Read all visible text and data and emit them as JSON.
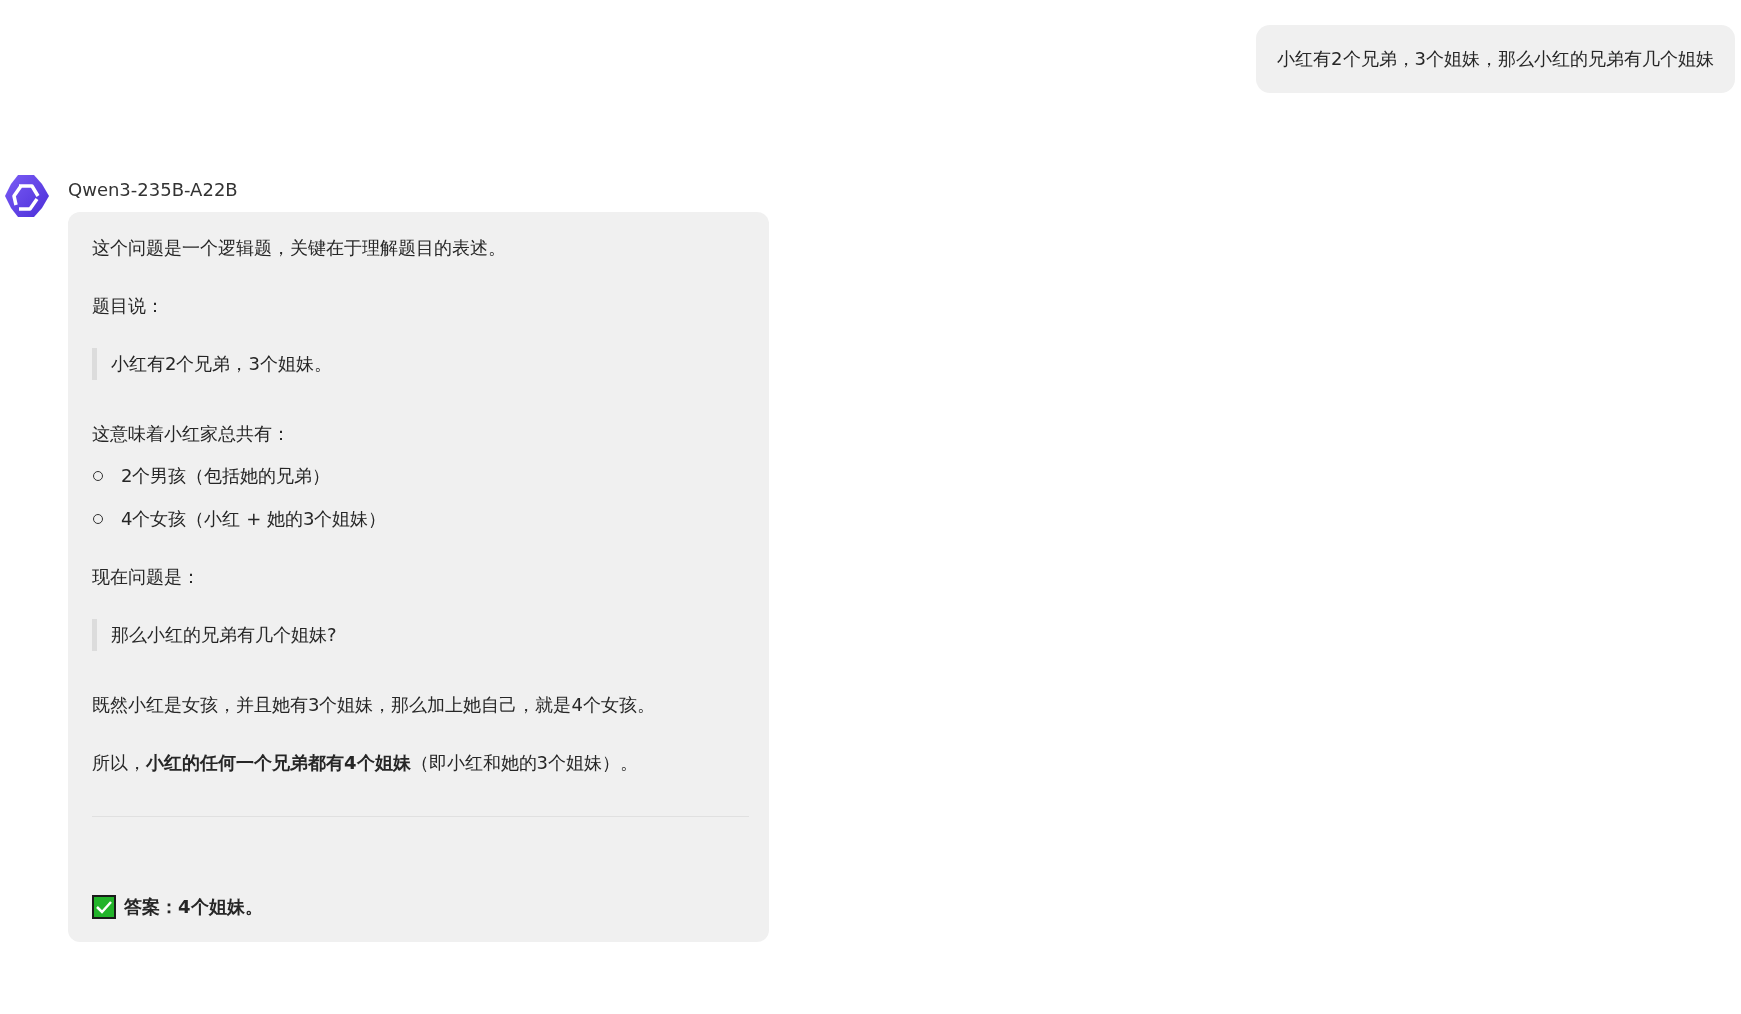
{
  "user_message": {
    "text": "小红有2个兄弟，3个姐妹，那么小红的兄弟有几个姐妹"
  },
  "assistant": {
    "model_name": "Qwen3-235B-A22B",
    "blocks": [
      {
        "kind": "paragraph",
        "text": "这个问题是一个逻辑题，关键在于理解题目的表述。"
      },
      {
        "kind": "paragraph",
        "text": "题目说："
      },
      {
        "kind": "quote",
        "text": "小红有2个兄弟，3个姐妹。"
      },
      {
        "kind": "paragraph",
        "text": "这意味着小红家总共有："
      },
      {
        "kind": "bullets",
        "items": [
          "2个男孩（包括她的兄弟）",
          "4个女孩（小红 + 她的3个姐妹）"
        ]
      },
      {
        "kind": "paragraph",
        "text": "现在问题是："
      },
      {
        "kind": "quote",
        "text": "那么小红的兄弟有几个姐妹?"
      },
      {
        "kind": "paragraph",
        "text": "既然小红是女孩，并且她有3个姐妹，那么加上她自己，就是4个女孩。"
      },
      {
        "kind": "paragraph",
        "text": "所以，**小红的任何一个兄弟都有4个姐妹**（即小红和她的3个姐妹）。"
      },
      {
        "kind": "divider"
      },
      {
        "kind": "answer",
        "checked": true,
        "text": "答案：4个姐妹。"
      }
    ]
  }
}
